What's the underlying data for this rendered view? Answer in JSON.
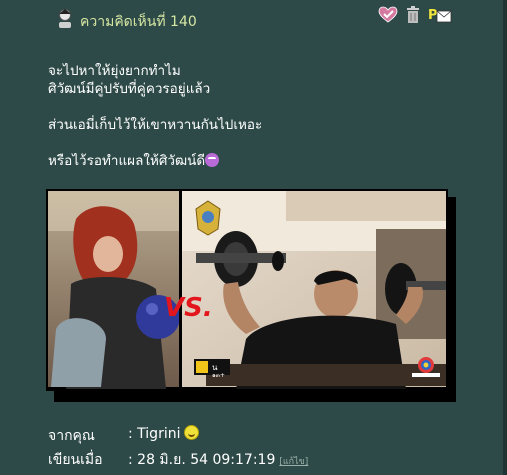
{
  "comment": {
    "title": "ความคิดเห็นที่ 140",
    "lines": [
      "จะไปหาให้ยุ่งยากทำไม",
      "ศิวัฒน์มีคู่ปรับที่คู่ควรอยู่แล้ว",
      "ส่วนเอมี่เก็บไว้ให้เขาหวานกันไปเหอะ",
      "หรือไว้รอทำแผลให้ศิวัฒน์ดี"
    ],
    "emoji_icon": "grin-purple-icon"
  },
  "tools": {
    "icons": [
      "heart-check-icon",
      "trash-icon",
      "private-message-icon"
    ]
  },
  "image": {
    "vs_text": "VS.",
    "channel_text": "น",
    "rating_text": "๑๓+"
  },
  "meta": {
    "from_label": "จากคุณ",
    "from_value": ": Tigrini",
    "posted_label": "เขียนเมื่อ",
    "posted_value": ": 28 มิ.ย. 54 09:17:19",
    "edit_label": "[แก้ไข]",
    "smiley_icon": "smiley-icon"
  },
  "colors": {
    "background": "#2d4a48",
    "title": "#d6e6a3",
    "text": "#ffffff"
  }
}
